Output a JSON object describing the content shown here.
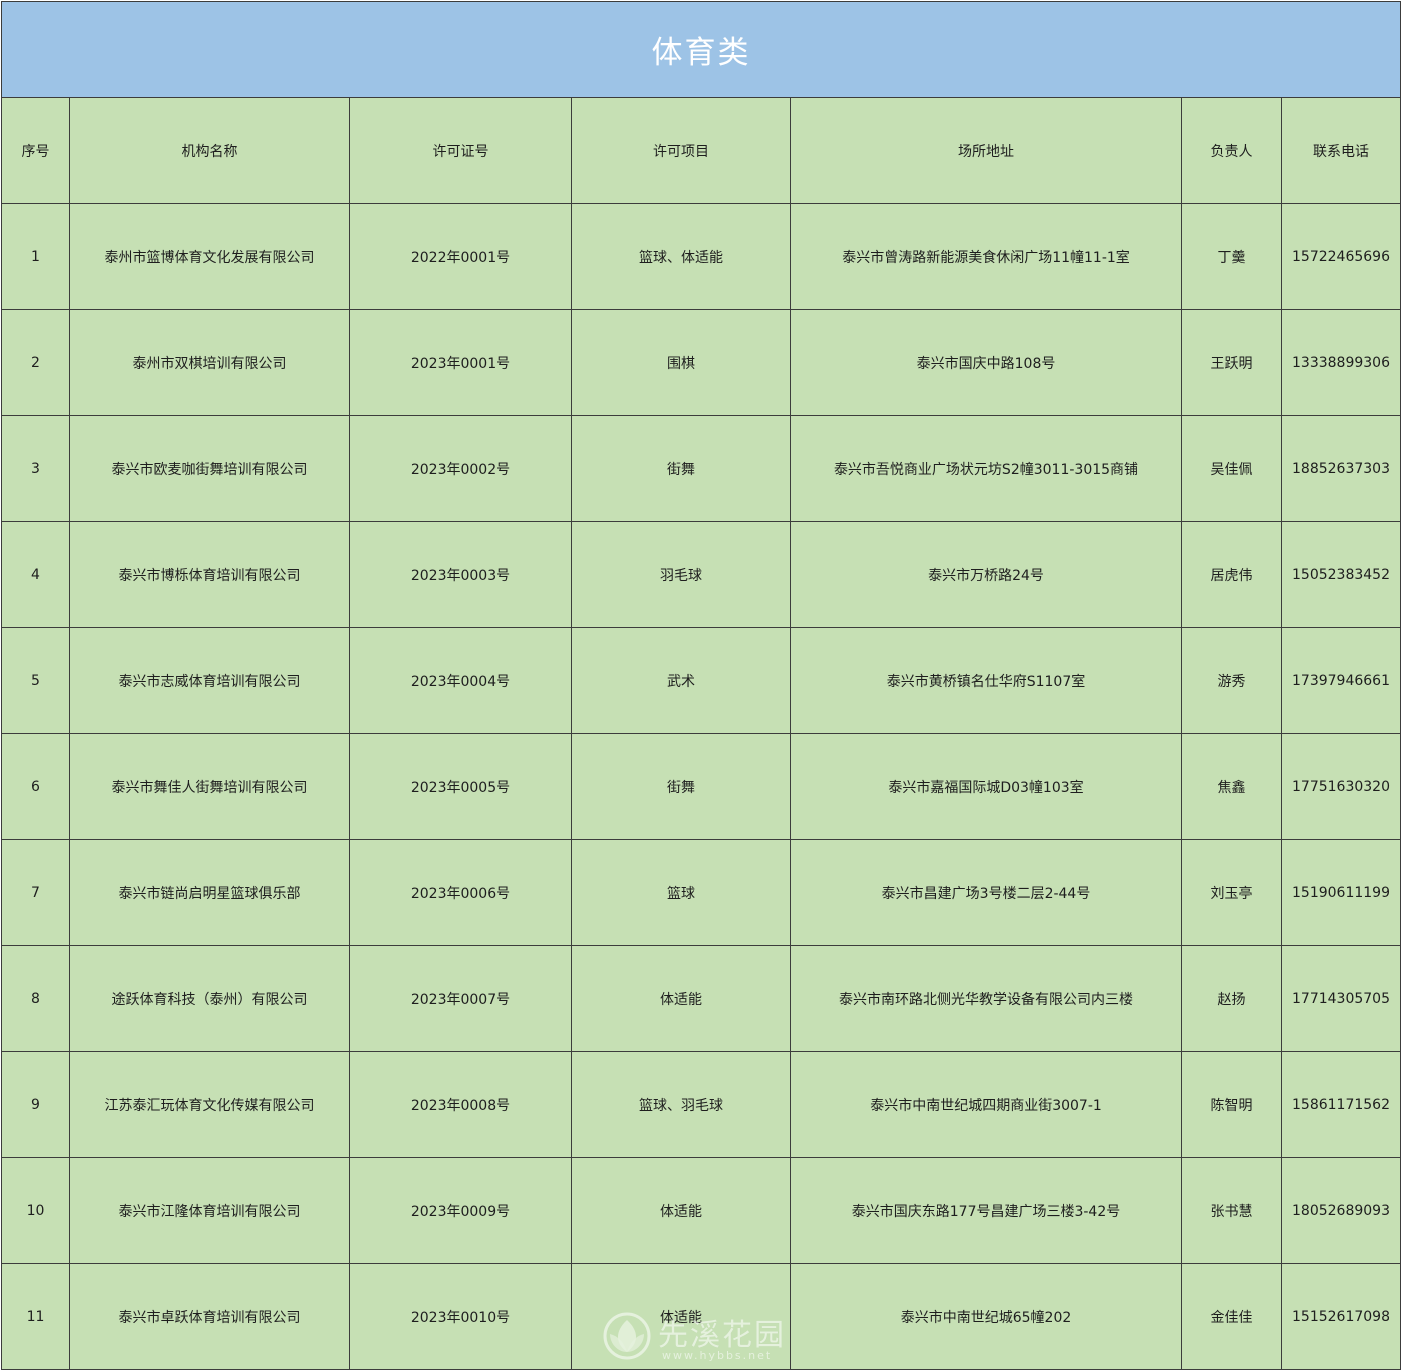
{
  "title": "体育类",
  "columns": [
    "序号",
    "机构名称",
    "许可证号",
    "许可项目",
    "场所地址",
    "负责人",
    "联系电话"
  ],
  "rows": [
    [
      "1",
      "泰州市篮博体育文化发展有限公司",
      "2022年0001号",
      "篮球、体适能",
      "泰兴市曾涛路新能源美食休闲广场11幢11-1室",
      "丁羹",
      "15722465696"
    ],
    [
      "2",
      "泰州市双棋培训有限公司",
      "2023年0001号",
      "围棋",
      "泰兴市国庆中路108号",
      "王跃明",
      "13338899306"
    ],
    [
      "3",
      "泰兴市欧麦咖街舞培训有限公司",
      "2023年0002号",
      "街舞",
      "泰兴市吾悦商业广场状元坊S2幢3011-3015商铺",
      "吴佳佩",
      "18852637303"
    ],
    [
      "4",
      "泰兴市博栎体育培训有限公司",
      "2023年0003号",
      "羽毛球",
      "泰兴市万桥路24号",
      "居虎伟",
      "15052383452"
    ],
    [
      "5",
      "泰兴市志威体育培训有限公司",
      "2023年0004号",
      "武术",
      "泰兴市黄桥镇名仕华府S1107室",
      "游秀",
      "17397946661"
    ],
    [
      "6",
      "泰兴市舞佳人街舞培训有限公司",
      "2023年0005号",
      "街舞",
      "泰兴市嘉福国际城D03幢103室",
      "焦鑫",
      "17751630320"
    ],
    [
      "7",
      "泰兴市链尚启明星篮球俱乐部",
      "2023年0006号",
      "篮球",
      "泰兴市昌建广场3号楼二层2-44号",
      "刘玉亭",
      "15190611199"
    ],
    [
      "8",
      "途跃体育科技（泰州）有限公司",
      "2023年0007号",
      "体适能",
      "泰兴市南环路北侧光华教学设备有限公司内三楼",
      "赵扬",
      "17714305705"
    ],
    [
      "9",
      "江苏泰汇玩体育文化传媒有限公司",
      "2023年0008号",
      "篮球、羽毛球",
      "泰兴市中南世纪城四期商业街3007-1",
      "陈智明",
      "15861171562"
    ],
    [
      "10",
      "泰兴市江隆体育培训有限公司",
      "2023年0009号",
      "体适能",
      "泰兴市国庆东路177号昌建广场三楼3-42号",
      "张书慧",
      "18052689093"
    ],
    [
      "11",
      "泰兴市卓跃体育培训有限公司",
      "2023年0010号",
      "体适能",
      "泰兴市中南世纪城65幢202",
      "金佳佳",
      "15152617098"
    ]
  ],
  "watermark": {
    "name": "先溪花园",
    "url": "www.hybbs.net",
    "icon": "flower-logo-icon"
  },
  "colors": {
    "title_bg": "#9dc3e6",
    "cell_bg": "#c6e0b4",
    "border": "#3c3c3c",
    "title_text": "#ffffff"
  }
}
